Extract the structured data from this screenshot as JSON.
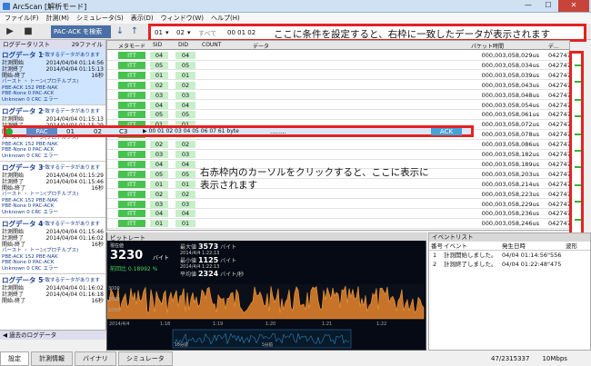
{
  "app_title": "ArcScan [解析モード]",
  "menu": [
    "ファイル(F)",
    "計測(M)",
    "シミュレータ(S)",
    "表示(D)",
    "ウィンドウ(W)",
    "ヘルプ(H)"
  ],
  "toolbar": {
    "search_label": "PAC-ACK を検索"
  },
  "filter": {
    "sel1": "01",
    "sel2": "02",
    "sel3": "すべて",
    "time": "00 01 02",
    "annotation": "ここに条件を設定すると、右枠に一致したデータが表示されます"
  },
  "left_panel": {
    "header": "ログデータリスト",
    "count": "29ファイル",
    "footer": "過去のログデータ",
    "entries": [
      {
        "name": "ログデータ 1",
        "tag": "一致するデータがあります",
        "start_label": "計測開始",
        "start": "2014/04/04 01:14:56",
        "end_label": "計測終了",
        "end": "2014/04/04 01:15:13",
        "dur_label": "開始-終了",
        "dur": "16秒",
        "stat1": "バースト  ・  トーン(プロチルプス)",
        "stat2": "PBE-ACK  152  PBE-NAK",
        "stat3": "PBE-None 0  PAC-ACK",
        "stat4": "Unknown  0  CRC エラー"
      },
      {
        "name": "ログデータ 2",
        "tag": "一致するデータがあります",
        "start_label": "計測開始",
        "start": "2014/04/04 01:15:13",
        "end_label": "計測終了",
        "end": "2014/04/04 01:15:29",
        "dur_label": "開始-終了",
        "dur": "16秒",
        "stat1": "バースト  ・  トーン(プロチルプス)",
        "stat2": "PBE-ACK  152  PBE-NAK",
        "stat3": "PBE-None 0  PAC-ACK",
        "stat4": "Unknown  0  CRC エラー"
      },
      {
        "name": "ログデータ 3",
        "tag": "一致するデータがあります",
        "start_label": "計測開始",
        "start": "2014/04/04 01:15:29",
        "end_label": "計測終了",
        "end": "2014/04/04 01:15:46",
        "dur_label": "開始-終了",
        "dur": "16秒",
        "stat1": "バースト  ・  トーン(プロチルプス)",
        "stat2": "PBE-ACK  152  PBE-NAK",
        "stat3": "PBE-None 0  PAC-ACK",
        "stat4": "Unknown  0  CRC エラー"
      },
      {
        "name": "ログデータ 4",
        "tag": "一致するデータがあります",
        "start_label": "計測開始",
        "start": "2014/04/04 01:15:46",
        "end_label": "計測終了",
        "end": "2014/04/04 01:16:02",
        "dur_label": "開始-終了",
        "dur": "16秒",
        "stat1": "バースト  ・  トーン(プロチルプス)",
        "stat2": "PBE-ACK  152  PBE-NAK",
        "stat3": "PBE-None 0  PAC-ACK",
        "stat4": "Unknown  0  CRC エラー"
      },
      {
        "name": "ログデータ 5",
        "tag": "一致するデータがあります",
        "start_label": "計測開始",
        "start": "2014/04/04 01:16:02",
        "end_label": "計測終了",
        "end": "2014/04/04 01:16:18",
        "dur_label": "開始-終了",
        "dur": "16秒",
        "stat1": "",
        "stat2": "",
        "stat3": "",
        "stat4": ""
      }
    ]
  },
  "grid": {
    "headers": [
      "メタモード",
      "SID",
      "DID",
      "COUNT",
      "データ",
      "パケット時間",
      "デ..."
    ],
    "rows": [
      {
        "type": "ITT",
        "sid": "04",
        "did": "04",
        "time": "000,003,058,029us",
        "d": "0427476"
      },
      {
        "type": "ITT",
        "sid": "05",
        "did": "05",
        "time": "000,003,058,034us",
        "d": "0427476"
      },
      {
        "type": "ITT",
        "sid": "01",
        "did": "01",
        "time": "000,003,058,039us",
        "d": "0427476"
      },
      {
        "type": "ITT",
        "sid": "02",
        "did": "02",
        "time": "000,003,058,043us",
        "d": "0427476"
      },
      {
        "type": "ITT",
        "sid": "03",
        "did": "03",
        "time": "000,003,058,048us",
        "d": "0427476"
      },
      {
        "type": "ITT",
        "sid": "04",
        "did": "04",
        "time": "000,003,058,054us",
        "d": "0427476"
      },
      {
        "type": "ITT",
        "sid": "05",
        "did": "05",
        "time": "000,003,058,061us",
        "d": "0427476"
      },
      {
        "type": "ITT",
        "sid": "01",
        "did": "01",
        "time": "000,003,058,072us",
        "d": "0427476"
      },
      {
        "type": "ITT",
        "sid": "02",
        "did": "02",
        "time": "000,003,058,078us",
        "d": "0427476"
      },
      {
        "type": "ITT",
        "sid": "02",
        "did": "02",
        "time": "000,003,058,086us",
        "d": "0427476"
      },
      {
        "type": "ITT",
        "sid": "03",
        "did": "03",
        "time": "000,003,058,182us",
        "d": "0427476"
      },
      {
        "type": "ITT",
        "sid": "04",
        "did": "04",
        "time": "000,003,058,189us",
        "d": "0427476"
      },
      {
        "type": "ITT",
        "sid": "05",
        "did": "05",
        "time": "000,003,058,203us",
        "d": "0427476"
      },
      {
        "type": "ITT",
        "sid": "01",
        "did": "01",
        "time": "000,003,058,214us",
        "d": "0427476"
      },
      {
        "type": "ITT",
        "sid": "02",
        "did": "02",
        "time": "000,003,058,223us",
        "d": "0427476"
      },
      {
        "type": "ITT",
        "sid": "03",
        "did": "03",
        "time": "000,003,058,229us",
        "d": "0427476"
      },
      {
        "type": "ITT",
        "sid": "04",
        "did": "04",
        "time": "000,003,058,236us",
        "d": "0427476"
      },
      {
        "type": "ITT",
        "sid": "01",
        "did": "01",
        "time": "000,003,058,246us",
        "d": "0427476"
      }
    ],
    "selected": {
      "type": "PAC",
      "sid": "01",
      "did": "02",
      "count": "C3",
      "data": "▶ 00 01 02 03 04 05 06 07   61 byte",
      "ellipsis": "........",
      "ack": "ACK",
      "time": "000,003,058,098us",
      "d": "0427476"
    }
  },
  "annotation_click": "右赤枠内のカーソルをクリックすると、ここに表示に表示されます",
  "bitrate": {
    "title": "ビットレート",
    "current_label": "現在値",
    "current": "3230",
    "current_unit": "バイト",
    "current_sub": "前回比 0.18992 %",
    "max_label": "最大値",
    "max": "3573",
    "max_unit": "バイト",
    "max_time": "2014/4/4 1:22:13",
    "min_label": "最小値",
    "min": "1125",
    "min_unit": "バイト",
    "min_time": "2014/4/4 1:22:13",
    "avg_label": "平均値",
    "avg": "2324",
    "avg_unit": "バイト/秒",
    "yaxis": [
      "3000",
      "2000",
      "1000"
    ],
    "xaxis": [
      "2014/4/4",
      "1:18",
      "1:19",
      "1:20",
      "1:21",
      "1:22"
    ],
    "overview_left": "10分前",
    "overview_right": "5分前"
  },
  "events": {
    "title": "イベントリスト",
    "headers": [
      "番号",
      "イベント",
      "発生日時",
      "波形"
    ],
    "rows": [
      {
        "no": "1",
        "event": "計測開始しました。",
        "time": "04/04 01:14:56\"556"
      },
      {
        "no": "2",
        "event": "計測終了しました。",
        "time": "04/04 01:22:48\"475"
      }
    ]
  },
  "tabs": [
    "設定",
    "計測情報",
    "バイナリ",
    "シミュレータ"
  ],
  "status": {
    "count": "47/2315337",
    "speed": "10Mbps"
  }
}
